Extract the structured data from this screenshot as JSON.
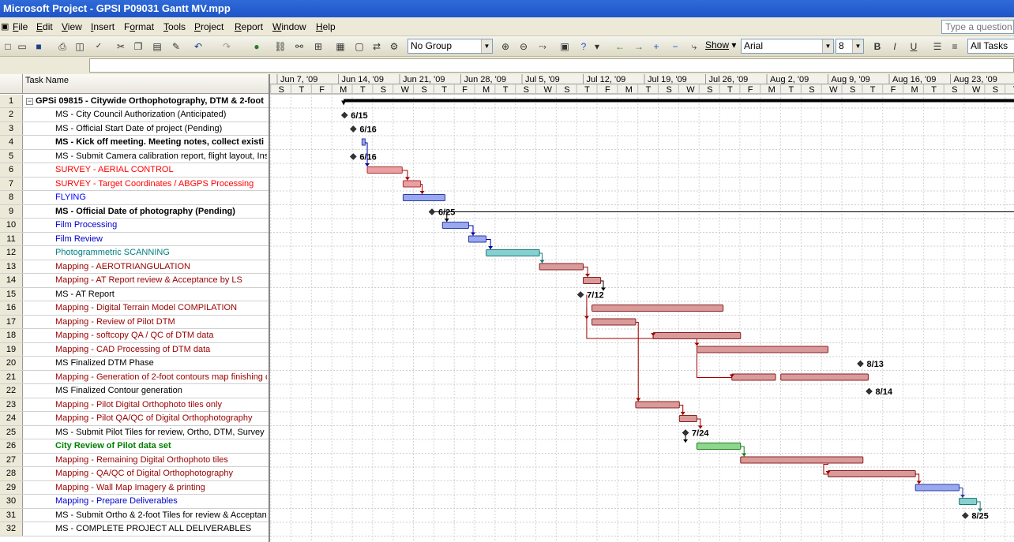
{
  "window": {
    "title": "Microsoft Project - GPSI P09031 Gantt MV.mpp"
  },
  "menu": [
    {
      "label": "File",
      "mn": "F",
      "rest": "ile"
    },
    {
      "label": "Edit",
      "mn": "E",
      "rest": "dit"
    },
    {
      "label": "View",
      "mn": "V",
      "rest": "iew"
    },
    {
      "label": "Insert",
      "mn": "I",
      "rest": "nsert"
    },
    {
      "label": "Format",
      "mn": "o",
      "pre": "F",
      "rest": "rmat"
    },
    {
      "label": "Tools",
      "mn": "T",
      "rest": "ools"
    },
    {
      "label": "Project",
      "mn": "P",
      "rest": "roject"
    },
    {
      "label": "Report",
      "mn": "R",
      "rest": "eport"
    },
    {
      "label": "Window",
      "mn": "W",
      "rest": "indow"
    },
    {
      "label": "Help",
      "mn": "H",
      "rest": "elp"
    }
  ],
  "ask": {
    "placeholder": "Type a question f"
  },
  "toolbar": {
    "group": "No Group",
    "show": "Show",
    "font": "Arial",
    "size": "8",
    "filter": "All Tasks"
  },
  "grid": {
    "header": "Task Name"
  },
  "timescale": {
    "weeks": [
      "Jun 7, '09",
      "Jun 14, '09",
      "Jun 21, '09",
      "Jun 28, '09",
      "Jul 5, '09",
      "Jul 12, '09",
      "Jul 19, '09",
      "Jul 26, '09",
      "Aug 2, '09",
      "Aug 9, '09",
      "Aug 16, '09",
      "Aug 23, '09"
    ],
    "days": [
      "S",
      "T",
      "F",
      "M",
      "T",
      "S",
      "W",
      "S",
      "T",
      "F",
      "M",
      "T",
      "S",
      "W",
      "S",
      "T",
      "F",
      "M",
      "T",
      "S",
      "W",
      "S",
      "T",
      "F",
      "M",
      "T",
      "S",
      "W",
      "S",
      "T",
      "F",
      "M",
      "T",
      "S",
      "W",
      "S",
      "T"
    ]
  },
  "colors": {
    "summary": "#000000",
    "red_bar": "#e8a0a4",
    "blue_bar": "#9aa8ee",
    "teal_bar": "#86d1cf",
    "green_bar": "#8ed88e",
    "dark_red_bar": "#d99a9a"
  },
  "tasks": [
    {
      "id": "1",
      "name": "GPSi 09815 -  Citywide Orthophotography, DTM & 2-foot",
      "bold": true,
      "color": "#000000",
      "summary": true,
      "indent": 0
    },
    {
      "id": "2",
      "name": "MS - City Council Authorization (Anticipated)",
      "color": "#000000",
      "indent": 1,
      "milestone": "6/15"
    },
    {
      "id": "3",
      "name": "MS - Official Start Date of project (Pending)",
      "color": "#000000",
      "indent": 1,
      "milestone": "6/16"
    },
    {
      "id": "4",
      "name": "MS - Kick off meeting. Meeting notes, collect existi",
      "bold": true,
      "color": "#000000",
      "indent": 1
    },
    {
      "id": "5",
      "name": "MS - Submit Camera calibration report, flight layout, Ins",
      "color": "#000000",
      "indent": 1,
      "milestone": "6/16"
    },
    {
      "id": "6",
      "name": "SURVEY - AERIAL CONTROL",
      "color": "#ff0000",
      "indent": 1
    },
    {
      "id": "7",
      "name": "SURVEY - Target Coordinates / ABGPS Processing",
      "color": "#ff0000",
      "indent": 1
    },
    {
      "id": "8",
      "name": "FLYING",
      "color": "#0000ff",
      "indent": 1
    },
    {
      "id": "9",
      "name": "MS - Official Date of photography (Pending)",
      "bold": true,
      "color": "#000000",
      "indent": 1,
      "milestone": "6/25"
    },
    {
      "id": "10",
      "name": "Film Processing",
      "color": "#0000cc",
      "indent": 1
    },
    {
      "id": "11",
      "name": "Film Review",
      "color": "#0000cc",
      "indent": 1
    },
    {
      "id": "12",
      "name": "Photogrammetric  SCANNING",
      "color": "#008080",
      "indent": 1
    },
    {
      "id": "13",
      "name": "Mapping - AEROTRIANGULATION",
      "color": "#990000",
      "indent": 1
    },
    {
      "id": "14",
      "name": "Mapping - AT Report review & Acceptance by LS",
      "color": "#990000",
      "indent": 1
    },
    {
      "id": "15",
      "name": "MS - AT Report",
      "color": "#000000",
      "indent": 1,
      "milestone": "7/12"
    },
    {
      "id": "16",
      "name": "Mapping - Digital Terrain Model COMPILATION",
      "color": "#990000",
      "indent": 1
    },
    {
      "id": "17",
      "name": "Mapping - Review of Pilot DTM",
      "color": "#990000",
      "indent": 1
    },
    {
      "id": "18",
      "name": "Mapping - softcopy QA / QC of DTM data",
      "color": "#990000",
      "indent": 1
    },
    {
      "id": "19",
      "name": "Mapping - CAD Processing of DTM data",
      "color": "#990000",
      "indent": 1
    },
    {
      "id": "20",
      "name": "MS Finalized DTM Phase",
      "color": "#000000",
      "indent": 1,
      "milestone": "8/13"
    },
    {
      "id": "21",
      "name": "Mapping - Generation of 2-foot contours map finishing o",
      "color": "#990000",
      "indent": 1
    },
    {
      "id": "22",
      "name": "MS Finalized Contour generation",
      "color": "#000000",
      "indent": 1,
      "milestone": "8/14"
    },
    {
      "id": "23",
      "name": "Mapping - Pilot Digital Orthophoto tiles only",
      "color": "#990000",
      "indent": 1
    },
    {
      "id": "24",
      "name": "Mapping - Pilot QA/QC of  Digital Orthophotography",
      "color": "#990000",
      "indent": 1
    },
    {
      "id": "25",
      "name": "MS - Submit Pilot Tiles for review, Ortho, DTM, Survey :",
      "color": "#000000",
      "indent": 1,
      "milestone": "7/24"
    },
    {
      "id": "26",
      "name": "City Review of Pilot data set",
      "bold": true,
      "color": "#008000",
      "indent": 1
    },
    {
      "id": "27",
      "name": "Mapping - Remaining  Digital Orthophoto tiles",
      "color": "#990000",
      "indent": 1
    },
    {
      "id": "28",
      "name": "Mapping - QA/QC of Digital Orthophotography",
      "color": "#990000",
      "indent": 1
    },
    {
      "id": "29",
      "name": "Mapping - Wall Map Imagery & printing",
      "color": "#990000",
      "indent": 1
    },
    {
      "id": "30",
      "name": "Mapping - Prepare Deliverables",
      "color": "#0000cc",
      "indent": 1
    },
    {
      "id": "31",
      "name": "MS - Submit Ortho & 2-foot Tiles for review & Acceptan",
      "color": "#000000",
      "indent": 1,
      "milestone": "8/25"
    },
    {
      "id": "32",
      "name": "MS - COMPLETE PROJECT ALL DELIVERABLES",
      "color": "#000000",
      "indent": 1
    }
  ]
}
